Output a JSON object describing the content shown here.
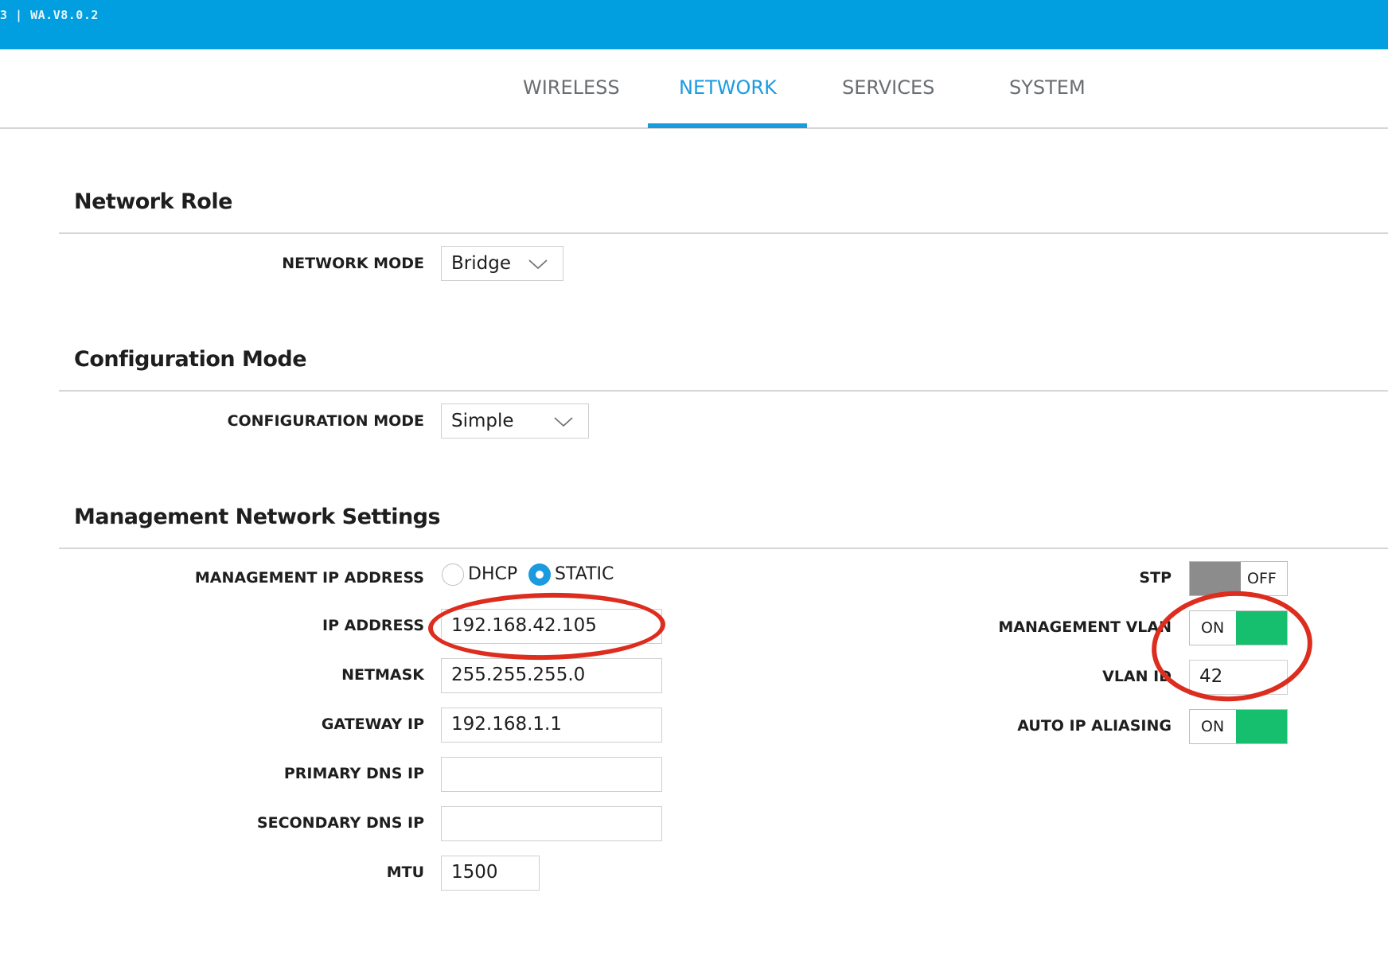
{
  "header": {
    "firmware": "3 | WA.V8.0.2"
  },
  "tabs": [
    {
      "label": "WIRELESS",
      "active": false
    },
    {
      "label": "NETWORK",
      "active": true
    },
    {
      "label": "SERVICES",
      "active": false
    },
    {
      "label": "SYSTEM",
      "active": false
    }
  ],
  "network_role": {
    "title": "Network Role",
    "network_mode_label": "NETWORK MODE",
    "network_mode_value": "Bridge"
  },
  "configuration_mode": {
    "title": "Configuration Mode",
    "configuration_mode_label": "CONFIGURATION MODE",
    "configuration_mode_value": "Simple"
  },
  "management": {
    "title": "Management Network Settings",
    "ip_mode_label": "MANAGEMENT IP ADDRESS",
    "dhcp_label": "DHCP",
    "static_label": "STATIC",
    "selected_mode": "STATIC",
    "ip_address_label": "IP ADDRESS",
    "ip_address": "192.168.42.105",
    "netmask_label": "NETMASK",
    "netmask": "255.255.255.0",
    "gateway_label": "GATEWAY IP",
    "gateway": "192.168.1.1",
    "primary_dns_label": "PRIMARY DNS IP",
    "primary_dns": "",
    "secondary_dns_label": "SECONDARY DNS IP",
    "secondary_dns": "",
    "mtu_label": "MTU",
    "mtu": "1500",
    "stp_label": "STP",
    "stp_state": "OFF",
    "mgmt_vlan_label": "MANAGEMENT VLAN",
    "mgmt_vlan_state": "ON",
    "vlan_id_label": "VLAN ID",
    "vlan_id": "42",
    "auto_ip_label": "AUTO IP ALIASING",
    "auto_ip_state": "ON"
  },
  "colors": {
    "header_blue": "#019fe0",
    "active_tab": "#1a9be0",
    "toggle_on": "#16bf6e",
    "toggle_off": "#8c8c8c",
    "annotation_red": "#dc2d1f"
  }
}
